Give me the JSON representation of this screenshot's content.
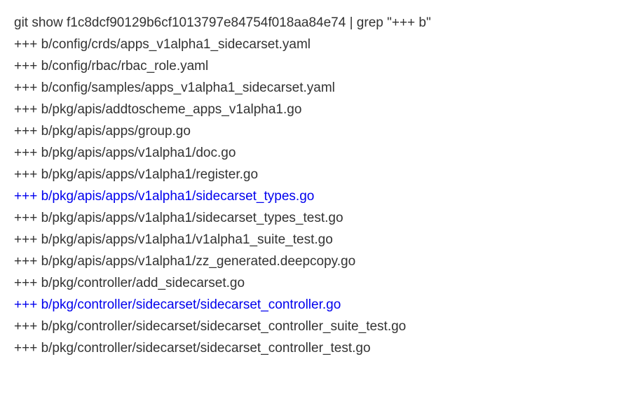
{
  "command": "git show f1c8dcf90129b6cf1013797e84754f018aa84e74 | grep \"+++ b\"",
  "output_lines": [
    {
      "text": "+++ b/config/crds/apps_v1alpha1_sidecarset.yaml",
      "highlighted": false
    },
    {
      "text": "+++ b/config/rbac/rbac_role.yaml",
      "highlighted": false
    },
    {
      "text": "+++ b/config/samples/apps_v1alpha1_sidecarset.yaml",
      "highlighted": false
    },
    {
      "text": "+++ b/pkg/apis/addtoscheme_apps_v1alpha1.go",
      "highlighted": false
    },
    {
      "text": "+++ b/pkg/apis/apps/group.go",
      "highlighted": false
    },
    {
      "text": "+++ b/pkg/apis/apps/v1alpha1/doc.go",
      "highlighted": false
    },
    {
      "text": "+++ b/pkg/apis/apps/v1alpha1/register.go",
      "highlighted": false
    },
    {
      "text": "+++ b/pkg/apis/apps/v1alpha1/sidecarset_types.go",
      "highlighted": true
    },
    {
      "text": "+++ b/pkg/apis/apps/v1alpha1/sidecarset_types_test.go",
      "highlighted": false
    },
    {
      "text": "+++ b/pkg/apis/apps/v1alpha1/v1alpha1_suite_test.go",
      "highlighted": false
    },
    {
      "text": "+++ b/pkg/apis/apps/v1alpha1/zz_generated.deepcopy.go",
      "highlighted": false
    },
    {
      "text": "+++ b/pkg/controller/add_sidecarset.go",
      "highlighted": false
    },
    {
      "text": "+++ b/pkg/controller/sidecarset/sidecarset_controller.go",
      "highlighted": true
    },
    {
      "text": "+++ b/pkg/controller/sidecarset/sidecarset_controller_suite_test.go",
      "highlighted": false
    },
    {
      "text": "+++ b/pkg/controller/sidecarset/sidecarset_controller_test.go",
      "highlighted": false
    }
  ]
}
